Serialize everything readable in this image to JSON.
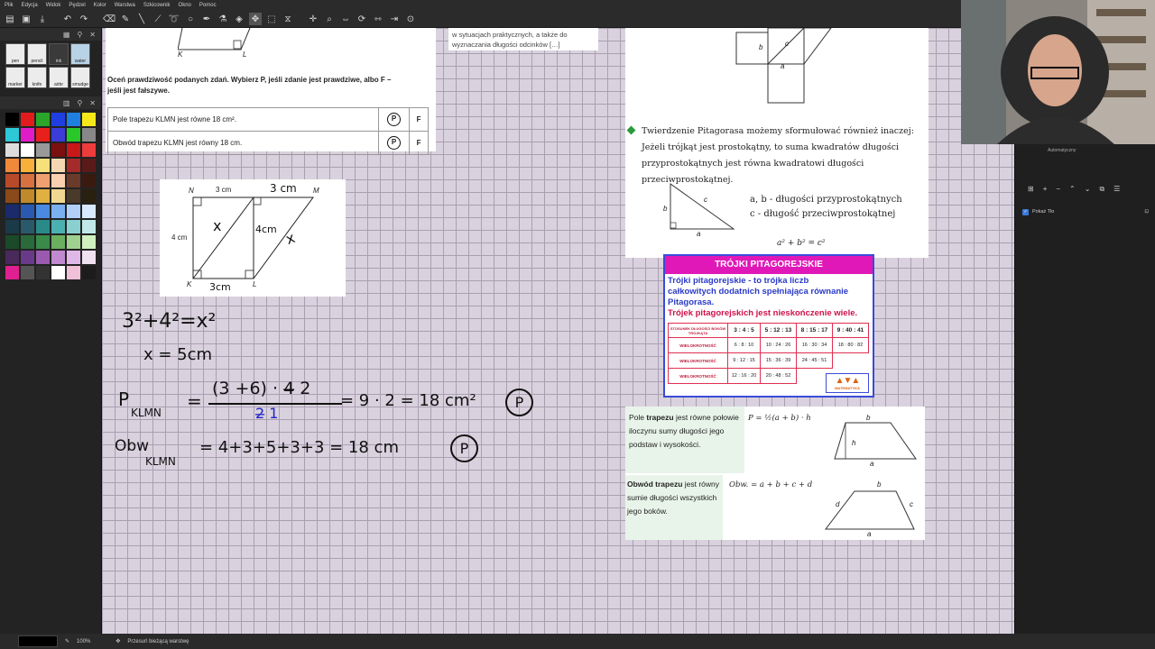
{
  "menu": {
    "items": [
      "Plik",
      "Edycja",
      "Widok",
      "Pędzel",
      "Kolor",
      "Warstwa",
      "Szkicownik",
      "Okno",
      "Pomoc"
    ]
  },
  "task": {
    "instruction_line1": "Oceń prawdziwość podanych zdań. Wybierz P, jeśli zdanie jest prawdziwe, albo F –",
    "instruction_line2": "jeśli jest fałszywe.",
    "row1": "Pole trapezu  KLMN  jest równe  18 cm².",
    "row2": "Obwód trapezu  KLMN  jest równy  18 cm.",
    "p": "P",
    "f": "F",
    "top_vertex_k": "K",
    "top_vertex_l": "L"
  },
  "note_top": {
    "line1": "w sytuacjach praktycznych, a także do",
    "line2": "wyznaczania długości odcinków […]"
  },
  "figure": {
    "n": "N",
    "m": "M",
    "k": "K",
    "l": "L",
    "top": "3 cm",
    "left": "4 cm"
  },
  "handwriting": {
    "top_label": "3 cm",
    "mid_label": "4cm",
    "bottom_label": "3cm",
    "x1": "x",
    "x2": "x",
    "eq1": "3²+4²=x²",
    "eq2": "x = 5cm",
    "pole_label": "P",
    "pole_sub": "KLMN",
    "pole_num": "(3 +6) · 4̶ 2",
    "pole_den": "2̶ 1",
    "pole_rhs": "= 9 · 2 = 18 cm²",
    "obw_label": "Obw",
    "obw_sub": "KLMN",
    "obw_rhs": "= 4+3+5+3+3 = 18 cm",
    "answer": "P"
  },
  "pythagoras": {
    "line1": "Twierdzenie Pitagorasa możemy sformułować również inaczej:",
    "line2": "Jeżeli trójkąt jest prostokątny, to suma kwadratów długości",
    "line3": "przyprostokątnych jest równa kwadratowi długości przeciwprostokątnej.",
    "legend1": "a, b - długości przyprostokątnych",
    "legend2": "c - długość  przeciwprostokątnej",
    "formula": "a² + b² = c²",
    "sq_a": "a",
    "sq_b": "b",
    "sq_c": "c",
    "tri_a": "a",
    "tri_b": "b",
    "tri_c": "c"
  },
  "triples": {
    "title": "TRÓJKI PITAGOREJSKIE",
    "desc1": "Trójki pitagorejskie - to trójka liczb",
    "desc2": "całkowitych dodatnich spełniająca równanie",
    "desc3": "Pitagorasa.",
    "desc4": "Trójek pitagorejskich jest nieskończenie wiele.",
    "header": [
      "STOSUNEK DŁUGOŚCI BOKÓW TRÓJKĄTA",
      "3 : 4 : 5",
      "5 : 12 : 13",
      "8 : 15 : 17",
      "9 : 40 : 41"
    ],
    "rows": [
      [
        "WIELOKROTNOŚĆ",
        "6 : 8 : 10",
        "10 : 24 : 26",
        "16 : 30 : 34",
        "18 : 80 : 82"
      ],
      [
        "WIELOKROTNOŚĆ",
        "9 : 12 : 15",
        "15 : 36 : 39",
        "24 : 45 : 51",
        ""
      ],
      [
        "WIELOKROTNOŚĆ",
        "12 : 16 : 20",
        "20 : 48 : 52",
        "",
        ""
      ]
    ],
    "logo": "MATEMATYKA"
  },
  "trapez": {
    "pole_text1": "Pole ",
    "pole_bold": "trapezu",
    "pole_text2": " jest równe połowie iloczynu sumy długości jego podstaw i wysokości.",
    "pole_formula": "P = ½(a + b) · h",
    "obw_bold": "Obwód trapezu",
    "obw_text": " jest równy sumie długości wszystkich jego boków.",
    "obw_formula": "Obw. = a + b + c + d",
    "a": "a",
    "b": "b",
    "h": "h",
    "c": "c",
    "d": "d"
  },
  "layers": {
    "name": "Pokaż Tło",
    "top_label": "Automatyczny"
  },
  "status": {
    "zoom": "100%",
    "text": "Przesuń bieżącą warstwę"
  }
}
